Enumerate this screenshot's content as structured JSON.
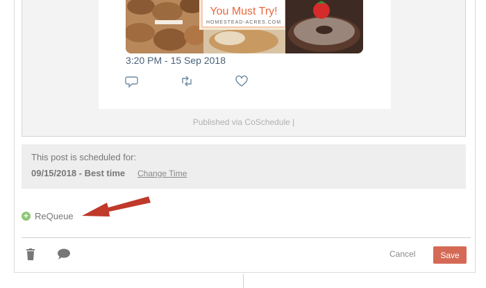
{
  "tweet": {
    "image": {
      "banner_title": "You Must Try!",
      "banner_url": "HOMESTEAD-ACRES.COM"
    },
    "timestamp": "3:20 PM - 15 Sep 2018",
    "actions": [
      "reply-icon",
      "retweet-icon",
      "like-icon"
    ]
  },
  "preview": {
    "published_via": "Published via CoSchedule |"
  },
  "schedule": {
    "label": "This post is scheduled for:",
    "date": "09/15/2018 - Best time",
    "change_time": "Change Time"
  },
  "requeue": {
    "label": "ReQueue"
  },
  "footer": {
    "cancel": "Cancel",
    "save": "Save"
  },
  "colors": {
    "accent_save": "#d46a56",
    "requeue_green": "#8cc675",
    "annotation_arrow": "#c0392b",
    "tweet_text": "#4a6077"
  }
}
